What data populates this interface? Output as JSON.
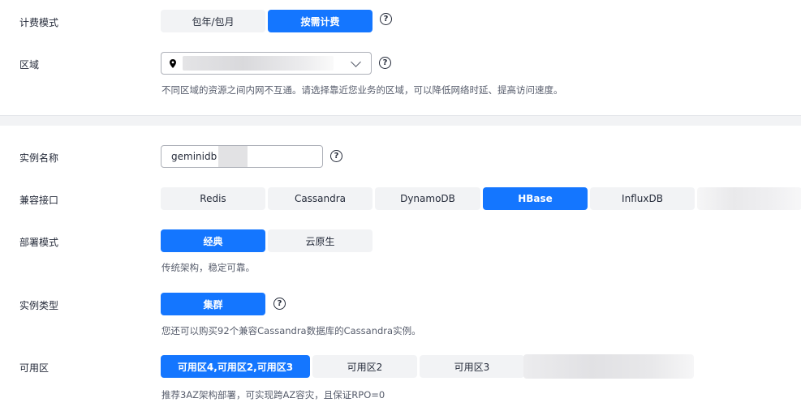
{
  "billing": {
    "label": "计费模式",
    "options": [
      "包年/包月",
      "按需计费"
    ],
    "selected": "按需计费"
  },
  "region": {
    "label": "区域",
    "hint": "不同区域的资源之间内网不互通。请选择靠近您业务的区域，可以降低网络时延、提高访问速度。"
  },
  "instance_name": {
    "label": "实例名称",
    "value": "geminidb"
  },
  "compat": {
    "label": "兼容接口",
    "options": [
      "Redis",
      "Cassandra",
      "DynamoDB",
      "HBase",
      "InfluxDB"
    ],
    "selected": "HBase"
  },
  "deploy": {
    "label": "部署模式",
    "options": [
      "经典",
      "云原生"
    ],
    "selected": "经典",
    "hint": "传统架构，稳定可靠。"
  },
  "instance_type": {
    "label": "实例类型",
    "options": [
      "集群"
    ],
    "selected": "集群",
    "hint": "您还可以购买92个兼容Cassandra数据库的Cassandra实例。"
  },
  "az": {
    "label": "可用区",
    "options": [
      "可用区4,可用区2,可用区3",
      "可用区2",
      "可用区3"
    ],
    "selected": "可用区4,可用区2,可用区3",
    "hint": "推荐3AZ架构部署，可实现跨AZ容灾，且保证RPO=0"
  },
  "help_glyph": "?",
  "icons": {
    "help": "question-circle-icon",
    "location": "location-pin-icon",
    "dropdown": "chevron-down-icon"
  },
  "colors": {
    "accent": "#1476ff",
    "segment_bg": "#f2f3f5",
    "text": "#252b3a",
    "hint": "#575d6c"
  }
}
